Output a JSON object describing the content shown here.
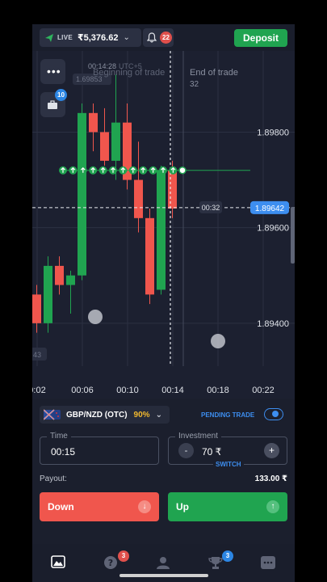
{
  "header": {
    "account_type": "LIVE",
    "balance": "₹5,376.62",
    "notifications_count": "22",
    "deposit_label": "Deposit"
  },
  "chart_data": {
    "type": "candlestick",
    "asset": "GBP/NZD (OTC)",
    "x_ticks": [
      "0:02",
      "00:06",
      "00:10",
      "00:14",
      "00:18",
      "00:22"
    ],
    "y_ticks": [
      "1.89800",
      "1.89600",
      "1.89400"
    ],
    "ylim": [
      1.8931,
      1.8997
    ],
    "current_price": "1.89642",
    "timer": "00:32",
    "trade_start_time": "00:14:28",
    "timezone_label": "UTC+5",
    "trade_marker_label": "1.69853",
    "beginning_label": "Beginning of trade",
    "end_label": "End of trade",
    "end_value": "32",
    "left_value_label": "43",
    "entry_price": 1.8972,
    "arrow_count": 12,
    "candles": [
      {
        "o": 1.8946,
        "c": 1.894,
        "h": 1.8948,
        "l": 1.8938
      },
      {
        "o": 1.894,
        "c": 1.8952,
        "h": 1.8954,
        "l": 1.8938
      },
      {
        "o": 1.8952,
        "c": 1.8948,
        "h": 1.8954,
        "l": 1.8946
      },
      {
        "o": 1.8948,
        "c": 1.895,
        "h": 1.8951,
        "l": 1.8942
      },
      {
        "o": 1.895,
        "c": 1.8984,
        "h": 1.8986,
        "l": 1.8949
      },
      {
        "o": 1.8984,
        "c": 1.898,
        "h": 1.8986,
        "l": 1.8976
      },
      {
        "o": 1.898,
        "c": 1.8974,
        "h": 1.8985,
        "l": 1.8973
      },
      {
        "o": 1.8974,
        "c": 1.8982,
        "h": 1.8992,
        "l": 1.897
      },
      {
        "o": 1.8982,
        "c": 1.897,
        "h": 1.8986,
        "l": 1.8968
      },
      {
        "o": 1.897,
        "c": 1.8962,
        "h": 1.8978,
        "l": 1.8959
      },
      {
        "o": 1.8962,
        "c": 1.8946,
        "h": 1.8964,
        "l": 1.8944
      },
      {
        "o": 1.8947,
        "c": 1.8972,
        "h": 1.8973,
        "l": 1.8946
      },
      {
        "o": 1.8972,
        "c": 1.8964,
        "h": 1.8974,
        "l": 1.8962
      }
    ]
  },
  "sidebar": {
    "menu_icon": "more-icon",
    "portfolio_badge": "10"
  },
  "controls": {
    "pair_label": "GBP/NZD (OTC)",
    "payout_percent": "90%",
    "pending_trade_label": "PENDING TRADE",
    "time_label": "Time",
    "time_value": "00:15",
    "investment_label": "Investment",
    "investment_value": "70 ₹",
    "switch_label": "SWITCH",
    "payout_label": "Payout:",
    "payout_value": "133.00 ₹",
    "down_label": "Down",
    "up_label": "Up"
  },
  "nav": {
    "help_badge": "3",
    "trophy_badge": "3"
  },
  "colors": {
    "up": "#20a450",
    "down": "#f0564d",
    "accent": "#3d8ef0"
  }
}
